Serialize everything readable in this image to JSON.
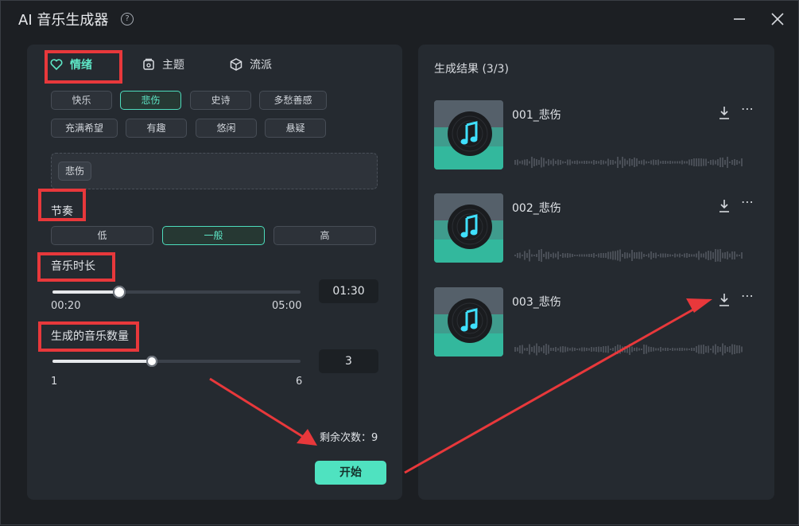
{
  "window": {
    "title": "AI 音乐生成器",
    "help_icon": "help-circle-icon",
    "minimize_icon": "minimize-icon",
    "close_icon": "close-icon"
  },
  "tabs": [
    {
      "label": "情绪",
      "icon": "heart-icon",
      "active": true
    },
    {
      "label": "主题",
      "icon": "album-icon",
      "active": false
    },
    {
      "label": "流派",
      "icon": "cube-icon",
      "active": false
    }
  ],
  "moods": [
    {
      "label": "快乐",
      "selected": false
    },
    {
      "label": "悲伤",
      "selected": true
    },
    {
      "label": "史诗",
      "selected": false
    },
    {
      "label": "多愁善感",
      "selected": false
    },
    {
      "label": "充满希望",
      "selected": false
    },
    {
      "label": "有趣",
      "selected": false
    },
    {
      "label": "悠闲",
      "selected": false
    },
    {
      "label": "悬疑",
      "selected": false
    }
  ],
  "selected_tags": [
    "悲伤"
  ],
  "rhythm": {
    "label": "节奏",
    "options": [
      {
        "label": "低",
        "selected": false
      },
      {
        "label": "一般",
        "selected": true
      },
      {
        "label": "高",
        "selected": false
      }
    ]
  },
  "duration": {
    "label": "音乐时长",
    "min_label": "00:20",
    "max_label": "05:00",
    "value": "01:30",
    "fraction": 0.27
  },
  "count": {
    "label": "生成的音乐数量",
    "min_label": "1",
    "max_label": "6",
    "value": "3",
    "fraction": 0.4
  },
  "remaining": "剩余次数：9",
  "start_label": "开始",
  "results": {
    "title": "生成结果 (3/3)",
    "items": [
      {
        "name": "001_悲伤",
        "download_icon": "download-icon",
        "more_icon": "more-icon",
        "cover_icon": "music-disc-icon"
      },
      {
        "name": "002_悲伤",
        "download_icon": "download-icon",
        "more_icon": "more-icon",
        "cover_icon": "music-disc-icon"
      },
      {
        "name": "003_悲伤",
        "download_icon": "download-icon",
        "more_icon": "more-icon",
        "cover_icon": "music-disc-icon"
      }
    ]
  },
  "colors": {
    "accent": "#4fe2c0",
    "annotation_red": "#e8383b",
    "panel_bg": "#252a30"
  }
}
